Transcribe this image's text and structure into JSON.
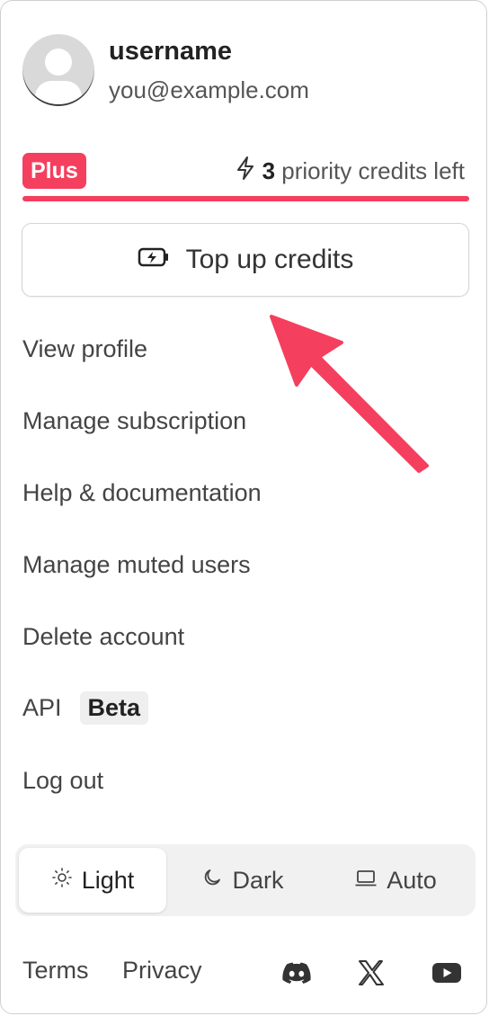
{
  "user": {
    "username": "username",
    "email": "you@example.com"
  },
  "plan": {
    "badge": "Plus",
    "credits_count": "3",
    "credits_text": "priority credits left",
    "credits_fraction": 1.0
  },
  "topup": {
    "label": "Top up credits"
  },
  "menu": [
    {
      "label": "View profile"
    },
    {
      "label": "Manage subscription"
    },
    {
      "label": "Help & documentation"
    },
    {
      "label": "Manage muted users"
    },
    {
      "label": "Delete account"
    },
    {
      "label": "API",
      "badge": "Beta"
    },
    {
      "label": "Log out"
    }
  ],
  "theme": {
    "options": [
      {
        "label": "Light",
        "icon": "sun-icon",
        "selected": true
      },
      {
        "label": "Dark",
        "icon": "moon-icon",
        "selected": false
      },
      {
        "label": "Auto",
        "icon": "laptop-icon",
        "selected": false
      }
    ]
  },
  "footer": {
    "terms": "Terms",
    "privacy": "Privacy",
    "socials": [
      "discord-icon",
      "x-icon",
      "youtube-icon"
    ]
  },
  "colors": {
    "accent": "#f43f5e",
    "annotation_arrow": "#f43f5e"
  }
}
